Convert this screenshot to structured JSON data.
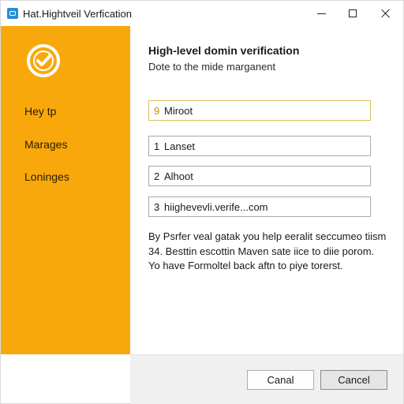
{
  "window": {
    "title": "Hat.Hightveil Verfication",
    "icon": "app-icon",
    "controls": [
      "minimize-icon",
      "maximize-icon",
      "close-icon"
    ]
  },
  "sidebar": {
    "background_color": "#f9a80b",
    "logo_icon": "checkmark-badge-icon",
    "items": [
      {
        "label": "Hey tp"
      },
      {
        "label": "Marages"
      },
      {
        "label": "Loninges"
      }
    ]
  },
  "main": {
    "heading": "High-level domin verification",
    "subheading": "Dote to the mide marganent",
    "fields": [
      {
        "number": "9",
        "value": "Miroot"
      },
      {
        "number": "1",
        "value": "Lanset"
      },
      {
        "number": "2",
        "value": "Alhoot"
      },
      {
        "number": "3",
        "value": "hiighevevli.verife...com"
      }
    ],
    "description": [
      "By Psrfer veal gatak you help eeralit seccumeo tiism",
      "34. Besttin escottin Maven sate iice to diie porom.",
      "Yo have Formoltel back aftn to piye torerst."
    ]
  },
  "footer": {
    "buttons": [
      {
        "label": "Canal"
      },
      {
        "label": "Cancel"
      }
    ]
  },
  "colors": {
    "accent": "#f9a80b",
    "focus_border": "#d9c15a"
  }
}
